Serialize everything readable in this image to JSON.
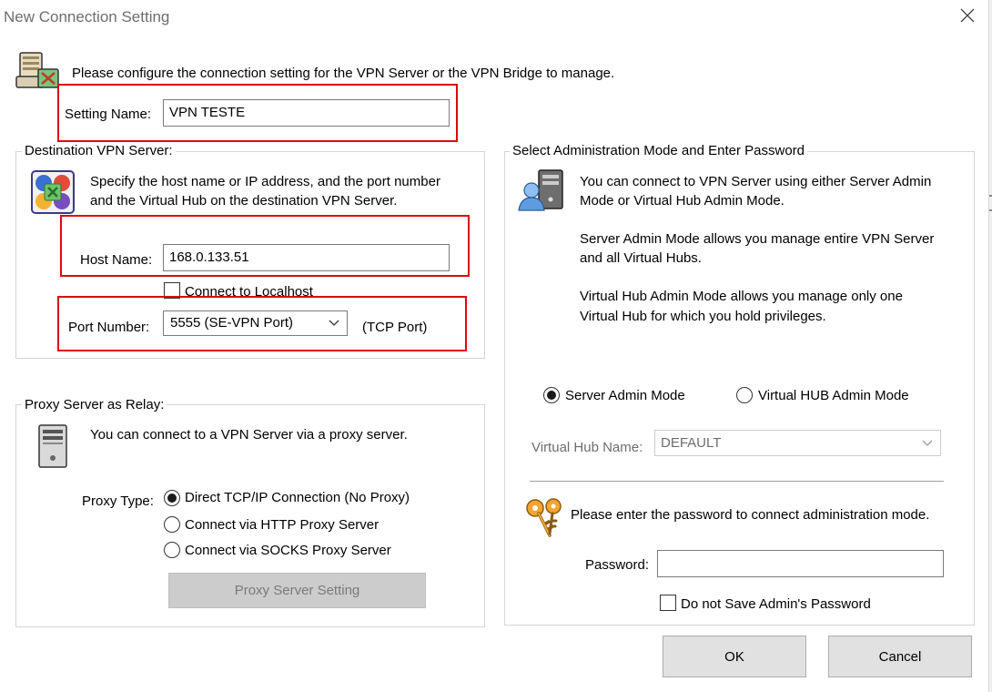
{
  "window": {
    "title": "New Connection Setting"
  },
  "header": {
    "intro": "Please configure the connection setting for the VPN Server or the VPN Bridge to manage."
  },
  "setting": {
    "label": "Setting Name:",
    "value": "VPN TESTE"
  },
  "destination": {
    "group_label": "Destination VPN Server:",
    "description_line1": "Specify the host name or IP address, and the port number",
    "description_line2": "and the Virtual Hub on the destination VPN Server.",
    "host_label": "Host Name:",
    "host_value": "168.0.133.51",
    "localhost_label": "Connect to Localhost",
    "localhost_checked": false,
    "port_label": "Port Number:",
    "port_value": "5555 (SE-VPN Port)",
    "port_suffix": "(TCP Port)"
  },
  "proxy": {
    "group_label": "Proxy Server as Relay:",
    "description": "You can connect to a VPN Server via a proxy server.",
    "type_label": "Proxy Type:",
    "options": [
      {
        "label": "Direct TCP/IP Connection (No Proxy)",
        "selected": true
      },
      {
        "label": "Connect via HTTP Proxy Server",
        "selected": false
      },
      {
        "label": "Connect via SOCKS Proxy Server",
        "selected": false
      }
    ],
    "setting_button": "Proxy Server Setting"
  },
  "admin": {
    "group_label": "Select Administration Mode and Enter Password",
    "para1_line1": "You can connect to VPN Server using either Server Admin",
    "para1_line2": "Mode or Virtual Hub Admin Mode.",
    "para2_line1": "Server Admin Mode allows you manage entire VPN Server",
    "para2_line2": "and all Virtual Hubs.",
    "para3_line1": "Virtual Hub Admin Mode allows you manage only one",
    "para3_line2": "Virtual Hub for which you hold privileges.",
    "mode_server": "Server Admin Mode",
    "mode_hub": "Virtual HUB Admin Mode",
    "selected_mode": "server",
    "hub_name_label": "Virtual Hub Name:",
    "hub_name_value": "DEFAULT",
    "password_prompt": "Please enter the password to connect administration mode.",
    "password_label": "Password:",
    "password_value": "",
    "nosave_label": "Do not Save Admin's Password",
    "nosave_checked": false
  },
  "buttons": {
    "ok": "OK",
    "cancel": "Cancel"
  },
  "colors": {
    "highlight_border": "#d90b0b",
    "group_border": "#d5d5d5",
    "disabled_text": "#6d6d6d",
    "button_face": "#e1e1e1"
  },
  "icons": {
    "header": "server-bridge-icon",
    "destination": "vpn-server-network-icon",
    "proxy": "proxy-tower-icon",
    "admin": "admin-user-server-icon",
    "password": "keys-icon",
    "close": "close-icon"
  }
}
